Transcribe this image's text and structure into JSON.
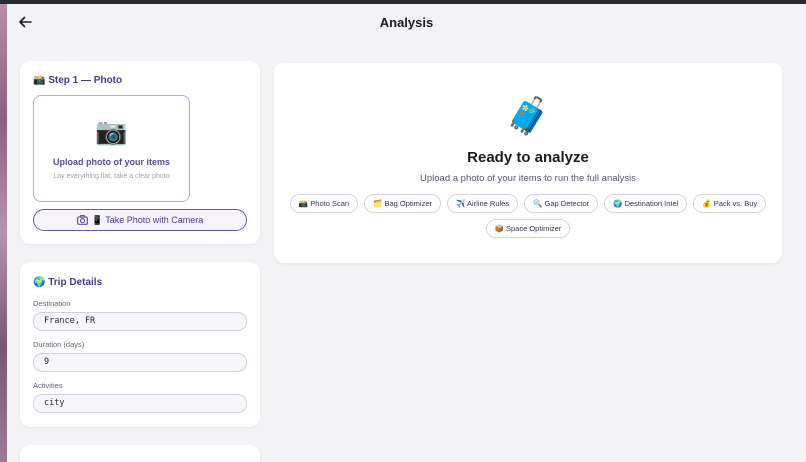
{
  "header": {
    "title": "Analysis"
  },
  "photo_card": {
    "title": "📸 Step 1 — Photo",
    "upload_icon": "📷",
    "upload_label": "Upload photo of your items",
    "upload_hint": "Lay everything flat, take a clear photo",
    "camera_button_label": "📱 Take Photo with Camera"
  },
  "trip_card": {
    "title": "🌍 Trip Details",
    "destination_label": "Destination",
    "destination_value": "France, FR",
    "duration_label": "Duration (days)",
    "duration_value": "9",
    "activities_label": "Activities",
    "activities_value": "city"
  },
  "main": {
    "icon": "🧳",
    "title": "Ready to analyze",
    "subtitle": "Upload a photo of your items to run the full analysis",
    "chips": [
      "📸 Photo Scan",
      "🗂️ Bag Optimizer",
      "✈️ Airline Rules",
      "🔍 Gap Detector",
      "🌍 Destination Intel",
      "💰 Pack vs. Buy",
      "📦 Space Optimizer"
    ]
  },
  "colors": {
    "accent": "#4a3a8a",
    "background": "#f3f2f5",
    "card": "#ffffff"
  },
  "icons": {
    "back": "arrow-left-icon",
    "camera": "camera-icon"
  }
}
